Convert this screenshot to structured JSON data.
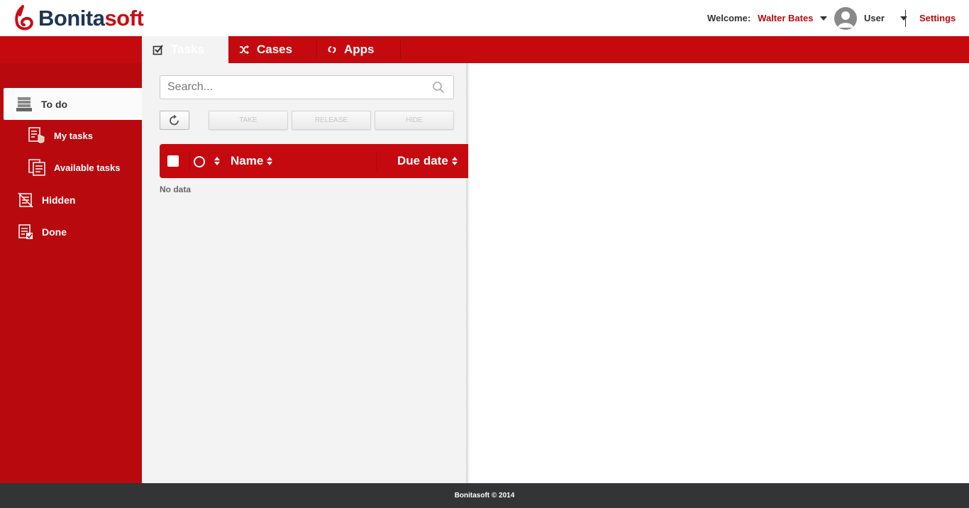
{
  "app": {
    "logo_text_1": "Bonita",
    "logo_text_2": "soft"
  },
  "header": {
    "welcome_label": "Welcome:",
    "user_name": "Walter Bates",
    "user_menu_label": "User",
    "settings_label": "Settings"
  },
  "tabs": [
    {
      "label": "Tasks",
      "icon": "checkbox-icon",
      "active": true
    },
    {
      "label": "Cases",
      "icon": "shuffle-icon",
      "active": false
    },
    {
      "label": "Apps",
      "icon": "apps-icon",
      "active": false
    }
  ],
  "sidebar": {
    "items": [
      {
        "label": "To do",
        "icon": "inbox-tray-icon",
        "active": true
      },
      {
        "label": "My tasks",
        "icon": "hand-list-icon"
      },
      {
        "label": "Available tasks",
        "icon": "list-icon"
      },
      {
        "label": "Hidden",
        "icon": "hidden-list-icon"
      },
      {
        "label": "Done",
        "icon": "done-list-icon"
      }
    ]
  },
  "toolbar": {
    "search_placeholder": "Search...",
    "take_label": "TAKE",
    "release_label": "RELEASE",
    "hide_label": "HIDE"
  },
  "table": {
    "columns": [
      "Name",
      "Due date"
    ],
    "empty_text": "No data"
  },
  "footer": {
    "text": "Bonitasoft © 2014"
  },
  "colors": {
    "primary_red": "#c50a0f",
    "sidebar_red": "#b80a0e",
    "footer_dark": "#333435",
    "navy": "#1f3552"
  }
}
